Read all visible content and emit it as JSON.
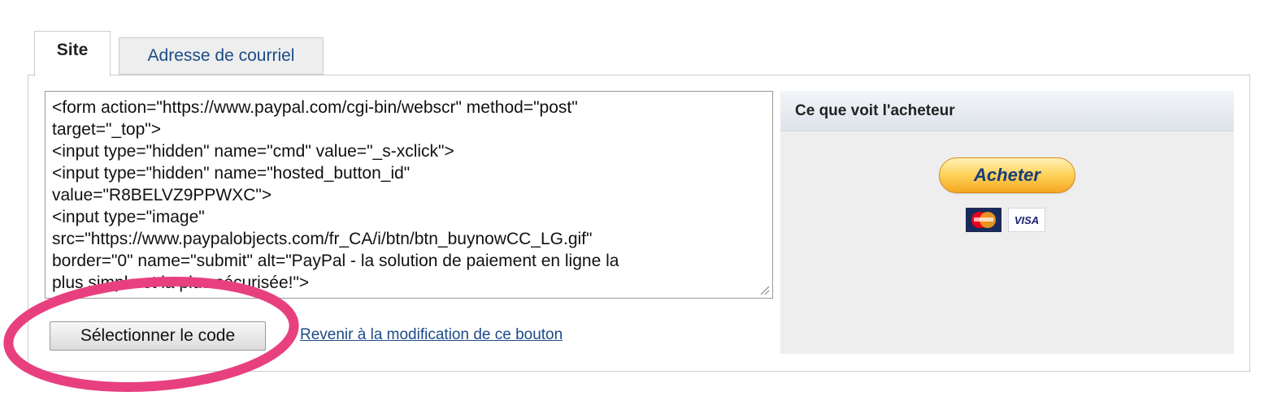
{
  "tabs": [
    {
      "label": "Site",
      "active": true
    },
    {
      "label": "Adresse de courriel",
      "active": false
    }
  ],
  "code": {
    "lines": [
      "<form action=\"https://www.paypal.com/cgi-bin/webscr\" method=\"post\"",
      "target=\"_top\">",
      "<input type=\"hidden\" name=\"cmd\" value=\"_s-xclick\">",
      "<input type=\"hidden\" name=\"hosted_button_id\"",
      "value=\"R8BELVZ9PPWXC\">",
      "<input type=\"image\"",
      "src=\"https://www.paypalobjects.com/fr_CA/i/btn/btn_buynowCC_LG.gif\"",
      "border=\"0\" name=\"submit\" alt=\"PayPal - la solution de paiement en ligne la",
      "plus simple et la plus sécurisée!\">"
    ]
  },
  "actions": {
    "select_code": "Sélectionner le code",
    "back_link": "Revenir à la modification de ce bouton"
  },
  "preview": {
    "title": "Ce que voit l'acheteur",
    "buy_button": "Acheter",
    "card_icons": [
      "mastercard-icon",
      "visa-icon"
    ],
    "visa_text": "VISA"
  },
  "colors": {
    "link": "#1c4b88",
    "annotation": "#e8407f",
    "buy_button": "#ffc439"
  }
}
